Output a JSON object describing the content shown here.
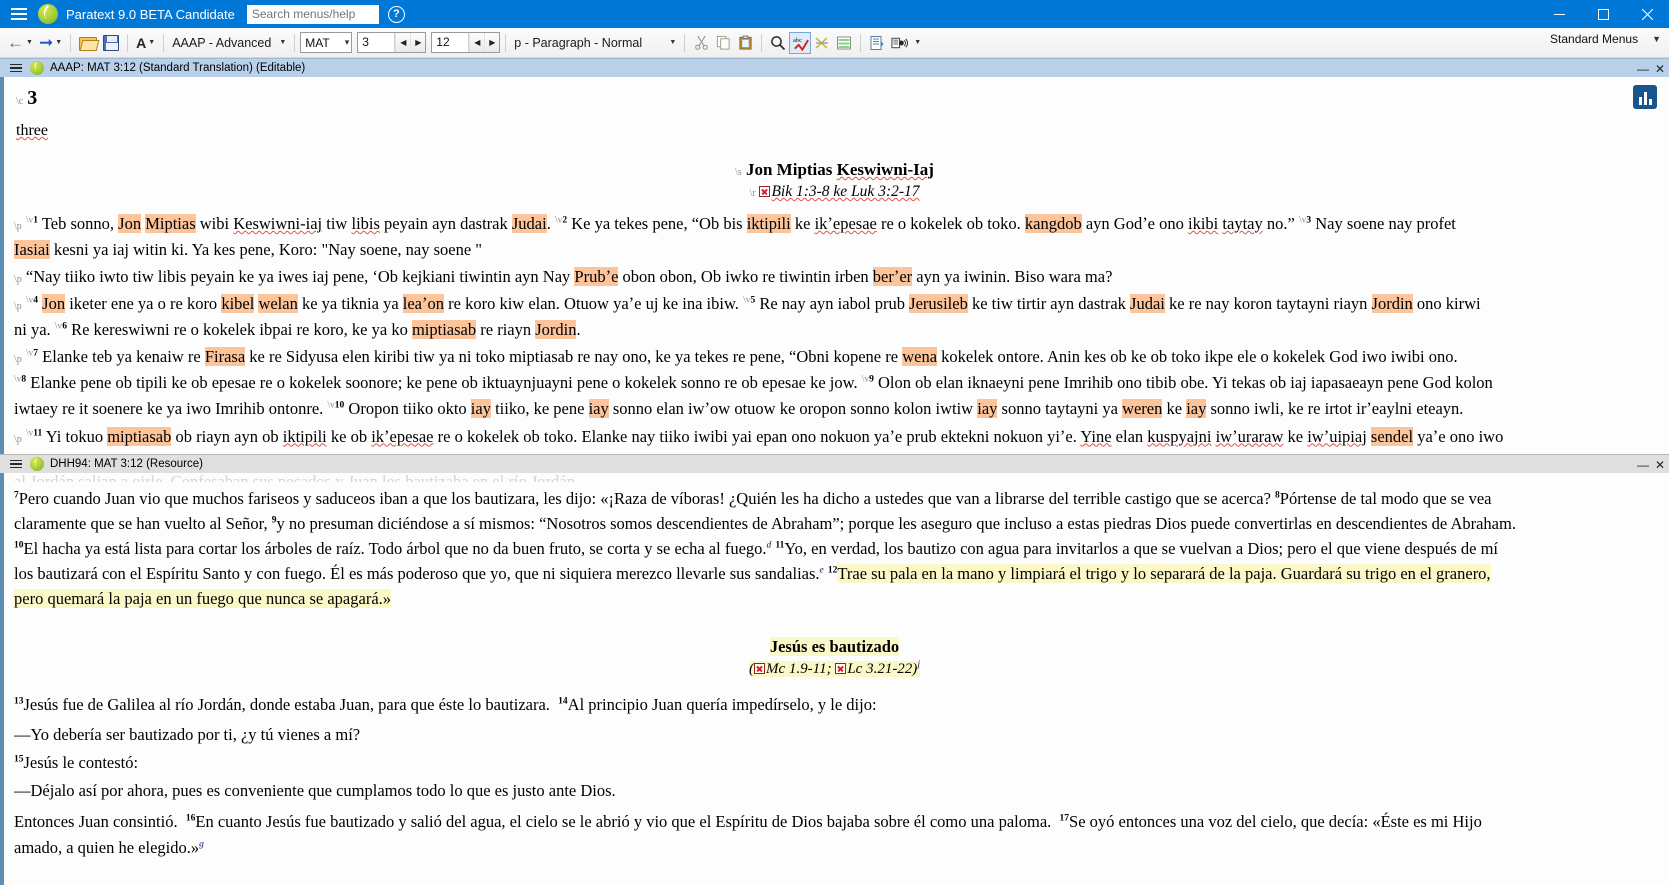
{
  "titlebar": {
    "app_title": "Paratext 9.0 BETA Candidate",
    "search_placeholder": "Search menus/help",
    "help_icon": "question-mark-icon",
    "minimize": "—",
    "maximize": "□",
    "close": "✕",
    "accent": "#0078d7"
  },
  "toolbar": {
    "back_label": "←",
    "forward_label": "➔",
    "open_label": "open-file-icon",
    "save_label": "save-icon",
    "font_label": "A",
    "project": "AAAP  - Advanced",
    "book": "MAT",
    "chapter": "3",
    "verse": "12",
    "style": "p - Paragraph - Normal",
    "cut": "cut-icon",
    "copy": "copy-icon",
    "paste": "paste-icon",
    "find": "find-icon",
    "spellcheck": "spellcheck-icon",
    "wordlist": "wordlist-icon",
    "interlinear": "interlinear-icon",
    "biblical_terms": "biblical-terms-icon",
    "audio": "audio-icon",
    "menus_mode": "Standard Menus"
  },
  "pane1": {
    "title": "AAAP: MAT 3:12 (Standard Translation) (Editable)",
    "minimize": "—",
    "close": "✕",
    "chapter_marker": "\\c",
    "chapter_number": "3",
    "chapter_word": "three",
    "section_marker": "\\s",
    "section_title": "Jon Miptias Keswiwni-Iaj",
    "ref_marker": "\\r",
    "ref_text": "Bik 1:3-8 ke Luk 3:2-17",
    "paragraphs": [
      "\\p \\v 1 Teb sonno, Jon Miptias wibi Keswiwni-iaj tiw libis peyain ayn dastrak Judai. \\v 2 Ke ya tekes pene, “Ob bis iktipili ke ikʼepesae re o kokelek ob toko. kangdob ayn Godʼe ono ikibi taytay no.” \\v 3 Nay soene nay profet Iasiai kesni ya iaj witin ki. Ya kes pene, Koro: \"Nay soene, nay soene \"",
      "\\p “Nay tiiko iwto tiw libis peyain ke ya iwes iaj pene, ‘Ob kejkiani tiwintin ayn Nay Prubʼe obon obon, Ob iwko re tiwintin irben berʼer ayn ya iwinin. Biso wara ma?",
      "\\p \\v 4 Jon iketer ene ya o re koro kibel welan ke ya tiknia ya leaʼon re koro kiw elan. Otuow yaʼe uj ke ina ibiw. \\v 5 Re nay ayn iabol prub Jerusileb ke tiw tirtir ayn dastrak Judai ke re nay koron taytayni riayn Jordin ono kirwi ni ya. \\v 6 Re kereswiwni re o kokelek ibpai re koro, ke ya ko miptiasab re riayn Jordin.",
      "\\p \\v 7 Elanke teb ya kenaiw re Firasa ke re Sidyusa elen kiribi tiw ya ni toko miptiasab re nay ono, ke ya tekes re pene, “Obni kopene re wena kokelek ontore. Anin kes ob ke ob toko ikpe ele o kokelek God iwo iwibi ono. \\v 8 Elanke pene ob tipili ke ob epesae re o kokelek soonore; ke pene ob iktuaynjuayni pene o kokelek sonno re ob epesae ke jow. \\v 9 Olon ob elan iknaeyni pene Imrihib ono tibib obe. Yi tekas ob iaj iapasaeayn pene God kolon iwtaey re it soenere ke ya iwo Imrihib ontonre. \\v 10 Oropon tiiko okto iay tiiko, ke pene iay sonno elan iwʼow otuow ke oropon sonno kolon iwtiw iay sonno taytayni ya weren ke iay sonno iwli, ke re irtot irʼeaylni eteayn.",
      "\\p \\v 11 Yi tokuo miptiasab ob riayn ayn ob iktipili ke ob ikʼepesae re o kokelek ob toko. Elanke nay tiiko iwibi yai epan ono nokuon yaʼe prub ektekni nokuon yiʼe. Yine elan kuspyajni iwʼuraraw ke iwʼuipiaj sendel yaʼe ono iwo"
    ],
    "highlights": [
      "Jon",
      "Miptias",
      "Judai",
      "iktipili",
      "kangdob",
      "Iasiai",
      "Prubʼe",
      "berʼer",
      "Jon",
      "kibel",
      "welan",
      "leaʼon",
      "Jerusileb",
      "Judai",
      "Jordin",
      "miptiasab",
      "Jordin",
      "Firasa",
      "wena",
      "iay",
      "iay",
      "iay",
      "weren",
      "iay",
      "miptiasab",
      "sendel"
    ],
    "chart_badge": "chart-icon"
  },
  "pane2": {
    "title": "DHH94: MAT 3:12 (Resource)",
    "minimize": "—",
    "close": "✕",
    "cut_line": "al Jordán salian a oirle.   Confesaban sus pecados y Juan los bautizaba en el río Jordán.",
    "paragraphs": [
      "7 Pero cuando Juan vio que muchos fariseos y saduceos iban a que los bautizara, les dijo: «¡Raza de víboras! ¿Quién les ha dicho a ustedes que van a librarse del terrible castigo que se acerca? 8 Pórtense de tal modo que se vea claramente que se han vuelto al Señor, 9 y no presuman diciéndose a sí mismos: “Nosotros somos descendientes de Abraham”; porque les aseguro que incluso a estas piedras Dios puede convertirlas en descendientes de Abraham. 10 El hacha ya está lista para cortar los árboles de raíz. Todo árbol que no da buen fruto, se corta y se echa al fuego. 11 Yo, en verdad, los bautizo con agua para invitarlos a que se vuelvan a Dios; pero el que viene después de mí los bautizará con el Espíritu Santo y con fuego. Él es más poderoso que yo, que ni siquiera merezco llevarle sus sandalias. 12 Trae su pala en la mano y limpiará el trigo y lo separará de la paja. Guardará su trigo en el granero, pero quemará la paja en un fuego que nunca se apagará.»"
    ],
    "section_title": "Jesús es bautizado",
    "ref_text": "(Mc 1.9-11; Lc 3.21-22)",
    "ref_note": "j",
    "body": [
      "13 Jesús fue de Galilea al río Jordán, donde estaba Juan, para que éste lo bautizara. 14 Al principio Juan quería impedírselo, y le dijo:",
      "—Yo debería ser bautizado por ti, ¿y tú vienes a mí?",
      "15 Jesús le contestó:",
      "—Déjalo así por ahora, pues es conveniente que cumplamos todo lo que es justo ante Dios.",
      "Entonces Juan consintió. 16 En cuanto Jesús fue bautizado y salió del agua, el cielo se le abrió y vio que el Espíritu de Dios bajaba sobre él como una paloma. 17 Se oyó entonces una voz del cielo, que decía: «Éste es mi Hijo amado, a quien he elegido.»"
    ],
    "footnote_markers": [
      "d",
      "e",
      "g",
      "j"
    ],
    "highlight_color": "#fbf8c8"
  }
}
